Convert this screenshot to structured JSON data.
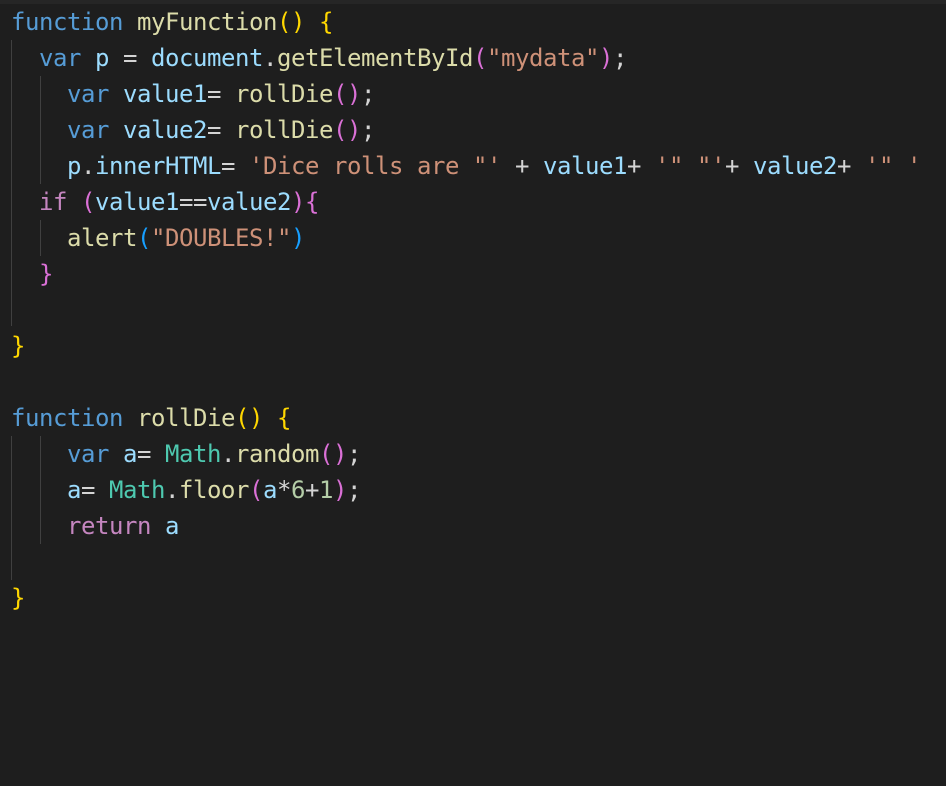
{
  "editor": {
    "language": "javascript",
    "theme": "dark",
    "colors": {
      "background": "#1e1e1e",
      "keyword": "#569cd6",
      "control_keyword": "#c586c0",
      "function": "#dcdcaa",
      "variable": "#9cdcfe",
      "string": "#ce9178",
      "number": "#b5cea8",
      "bracket_level_1": "#ffd700",
      "bracket_level_2": "#da70d6",
      "bracket_level_3": "#179fff"
    },
    "lines": [
      {
        "tokens": [
          {
            "text": "function",
            "kind": "kw"
          },
          {
            "text": " ",
            "kind": "op"
          },
          {
            "text": "myFunction",
            "kind": "fn"
          },
          {
            "text": "()",
            "kind": "p1"
          },
          {
            "text": " ",
            "kind": "op"
          },
          {
            "text": "{",
            "kind": "p1"
          }
        ]
      },
      {
        "tokens": [
          {
            "text": "  ",
            "kind": "op"
          },
          {
            "text": "var",
            "kind": "kw"
          },
          {
            "text": " ",
            "kind": "op"
          },
          {
            "text": "p",
            "kind": "var"
          },
          {
            "text": " = ",
            "kind": "op"
          },
          {
            "text": "document",
            "kind": "var"
          },
          {
            "text": ".",
            "kind": "op"
          },
          {
            "text": "getElementById",
            "kind": "fn"
          },
          {
            "text": "(",
            "kind": "p2"
          },
          {
            "text": "\"mydata\"",
            "kind": "str"
          },
          {
            "text": ")",
            "kind": "p2"
          },
          {
            "text": ";",
            "kind": "op"
          }
        ]
      },
      {
        "tokens": [
          {
            "text": "    ",
            "kind": "op"
          },
          {
            "text": "var",
            "kind": "kw"
          },
          {
            "text": " ",
            "kind": "op"
          },
          {
            "text": "value1",
            "kind": "var"
          },
          {
            "text": "= ",
            "kind": "op"
          },
          {
            "text": "rollDie",
            "kind": "fn"
          },
          {
            "text": "()",
            "kind": "p2"
          },
          {
            "text": ";",
            "kind": "op"
          }
        ]
      },
      {
        "tokens": [
          {
            "text": "    ",
            "kind": "op"
          },
          {
            "text": "var",
            "kind": "kw"
          },
          {
            "text": " ",
            "kind": "op"
          },
          {
            "text": "value2",
            "kind": "var"
          },
          {
            "text": "= ",
            "kind": "op"
          },
          {
            "text": "rollDie",
            "kind": "fn"
          },
          {
            "text": "()",
            "kind": "p2"
          },
          {
            "text": ";",
            "kind": "op"
          }
        ]
      },
      {
        "tokens": [
          {
            "text": "    ",
            "kind": "op"
          },
          {
            "text": "p",
            "kind": "var"
          },
          {
            "text": ".",
            "kind": "op"
          },
          {
            "text": "innerHTML",
            "kind": "var"
          },
          {
            "text": "= ",
            "kind": "op"
          },
          {
            "text": "'Dice rolls are \"'",
            "kind": "str"
          },
          {
            "text": " + ",
            "kind": "op"
          },
          {
            "text": "value1",
            "kind": "var"
          },
          {
            "text": "+ ",
            "kind": "op"
          },
          {
            "text": "'\" \"'",
            "kind": "str"
          },
          {
            "text": "+ ",
            "kind": "op"
          },
          {
            "text": "value2",
            "kind": "var"
          },
          {
            "text": "+ ",
            "kind": "op"
          },
          {
            "text": "'\" '",
            "kind": "str"
          }
        ]
      },
      {
        "tokens": [
          {
            "text": "  ",
            "kind": "op"
          },
          {
            "text": "if",
            "kind": "ctrl"
          },
          {
            "text": " ",
            "kind": "op"
          },
          {
            "text": "(",
            "kind": "p2"
          },
          {
            "text": "value1",
            "kind": "var"
          },
          {
            "text": "==",
            "kind": "op"
          },
          {
            "text": "value2",
            "kind": "var"
          },
          {
            "text": ")",
            "kind": "p2"
          },
          {
            "text": "{",
            "kind": "p2"
          }
        ]
      },
      {
        "tokens": [
          {
            "text": "    ",
            "kind": "op"
          },
          {
            "text": "alert",
            "kind": "fn"
          },
          {
            "text": "(",
            "kind": "p3"
          },
          {
            "text": "\"DOUBLES!\"",
            "kind": "str"
          },
          {
            "text": ")",
            "kind": "p3"
          }
        ]
      },
      {
        "tokens": [
          {
            "text": "  ",
            "kind": "op"
          },
          {
            "text": "}",
            "kind": "p2"
          }
        ]
      },
      {
        "tokens": []
      },
      {
        "tokens": [
          {
            "text": "}",
            "kind": "p1"
          }
        ]
      },
      {
        "tokens": []
      },
      {
        "tokens": [
          {
            "text": "function",
            "kind": "kw"
          },
          {
            "text": " ",
            "kind": "op"
          },
          {
            "text": "rollDie",
            "kind": "fn"
          },
          {
            "text": "()",
            "kind": "p1"
          },
          {
            "text": " ",
            "kind": "op"
          },
          {
            "text": "{",
            "kind": "p1"
          }
        ]
      },
      {
        "tokens": [
          {
            "text": "    ",
            "kind": "op"
          },
          {
            "text": "var",
            "kind": "kw"
          },
          {
            "text": " ",
            "kind": "op"
          },
          {
            "text": "a",
            "kind": "var"
          },
          {
            "text": "= ",
            "kind": "op"
          },
          {
            "text": "Math",
            "kind": "cls"
          },
          {
            "text": ".",
            "kind": "op"
          },
          {
            "text": "random",
            "kind": "fn"
          },
          {
            "text": "()",
            "kind": "p2"
          },
          {
            "text": ";",
            "kind": "op"
          }
        ]
      },
      {
        "tokens": [
          {
            "text": "    ",
            "kind": "op"
          },
          {
            "text": "a",
            "kind": "var"
          },
          {
            "text": "= ",
            "kind": "op"
          },
          {
            "text": "Math",
            "kind": "cls"
          },
          {
            "text": ".",
            "kind": "op"
          },
          {
            "text": "floor",
            "kind": "fn"
          },
          {
            "text": "(",
            "kind": "p2"
          },
          {
            "text": "a",
            "kind": "var"
          },
          {
            "text": "*",
            "kind": "op"
          },
          {
            "text": "6",
            "kind": "num"
          },
          {
            "text": "+",
            "kind": "op"
          },
          {
            "text": "1",
            "kind": "num"
          },
          {
            "text": ")",
            "kind": "p2"
          },
          {
            "text": ";",
            "kind": "op"
          }
        ]
      },
      {
        "tokens": [
          {
            "text": "    ",
            "kind": "op"
          },
          {
            "text": "return",
            "kind": "ctrl"
          },
          {
            "text": " ",
            "kind": "op"
          },
          {
            "text": "a",
            "kind": "var"
          }
        ]
      },
      {
        "tokens": []
      },
      {
        "tokens": [
          {
            "text": "}",
            "kind": "p1"
          }
        ]
      }
    ]
  }
}
